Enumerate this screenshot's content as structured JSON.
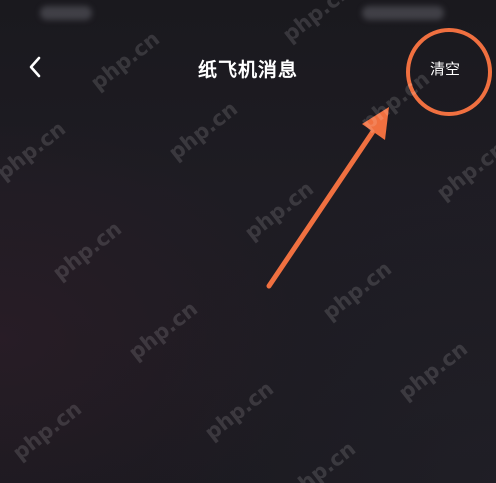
{
  "nav": {
    "title": "纸飞机消息",
    "clear_label": "清空"
  },
  "icons": {
    "back": "chevron-left-icon"
  },
  "annotation": {
    "color": "#f07040"
  },
  "watermark": {
    "text": "php.cn"
  },
  "colors": {
    "background": "#1c1a21",
    "text": "#ffffff"
  }
}
